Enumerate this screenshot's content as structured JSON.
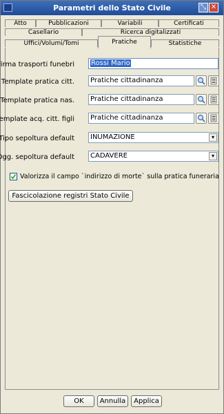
{
  "window": {
    "title": "Parametri dello Stato Civile"
  },
  "tabs": {
    "row1": [
      "Atto",
      "Pubblicazioni",
      "Variabili",
      "Certificati"
    ],
    "row2": [
      "Casellario",
      "Ricerca digitalizzati"
    ],
    "row3": [
      "Uffici/Volumi/Tomi",
      "Pratiche",
      "Statistiche"
    ],
    "active": "Pratiche"
  },
  "form": {
    "firma_label": "Firma trasporti funebri",
    "firma_value": "Rossi Mario",
    "tpl_citt_label": "Template pratica citt.",
    "tpl_citt_value": "Pratiche cittadinanza",
    "tpl_nas_label": "Template pratica nas.",
    "tpl_nas_value": "Pratiche cittadinanza",
    "tpl_acq_label": "Template acq. citt. figli",
    "tpl_acq_value": "Pratiche cittadinanza",
    "tipo_label": "Tipo sepoltura default",
    "tipo_value": "INUMAZIONE",
    "ogg_label": "Ogg. sepoltura default",
    "ogg_value": "CADAVERE",
    "checkbox_label": "Valorizza il campo `indirizzo di morte` sulla pratica funeraria",
    "checkbox_checked": true,
    "fascicolazione_button": "Fascicolazione registri Stato Civile"
  },
  "footer": {
    "ok": "OK",
    "annulla": "Annulla",
    "applica": "Applica"
  },
  "colors": {
    "title_bar": "#2a5aa8",
    "selection": "#316ac5"
  }
}
